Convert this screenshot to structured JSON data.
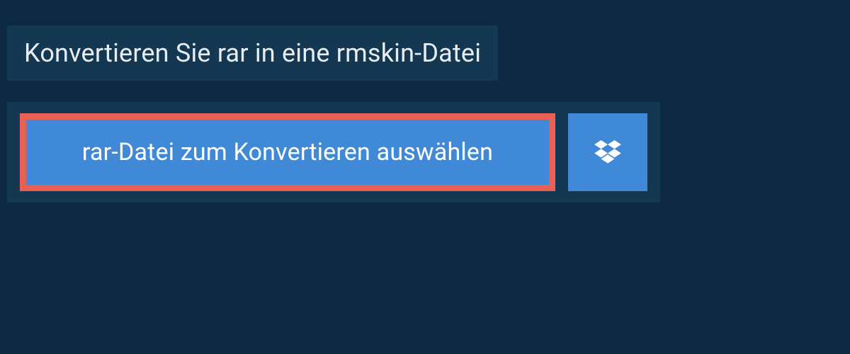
{
  "header": {
    "title": "Konvertieren Sie rar in eine rmskin-Datei"
  },
  "upload": {
    "select_file_label": "rar-Datei zum Konvertieren auswählen",
    "dropbox_icon": "dropbox"
  },
  "colors": {
    "background": "#0e2a42",
    "panel": "#143752",
    "button_primary": "#4089d6",
    "button_border_highlight": "#e85f54",
    "text_light": "#e8edf2",
    "text_white": "#ffffff"
  }
}
